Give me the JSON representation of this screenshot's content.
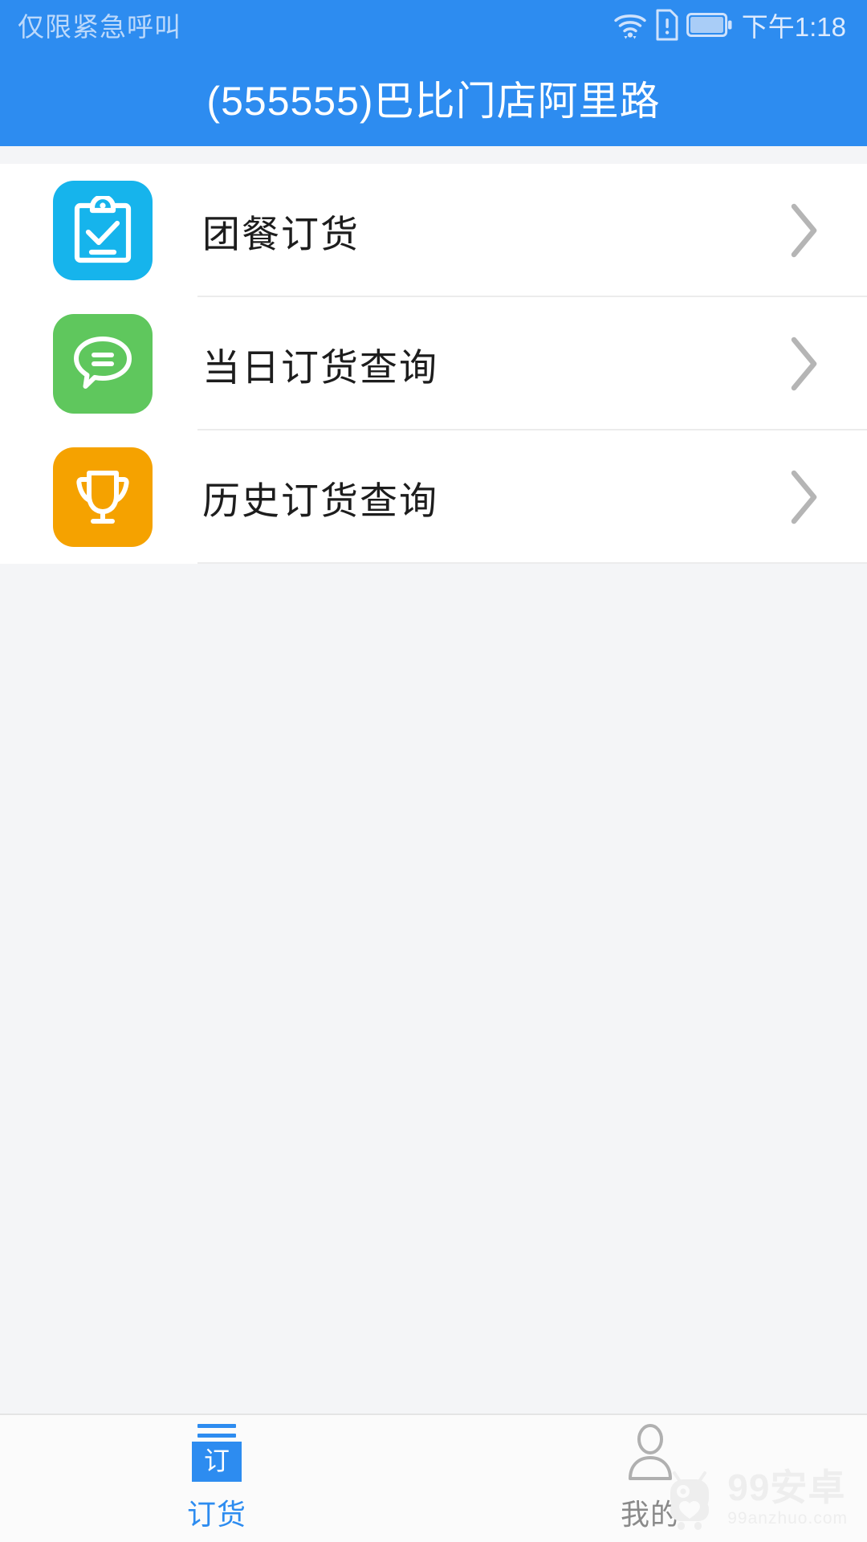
{
  "status_bar": {
    "carrier_text": "仅限紧急呼叫",
    "time": "下午1:18",
    "icons": [
      "wifi-icon",
      "sim-alert-icon",
      "battery-icon"
    ]
  },
  "header": {
    "title": "(555555)巴比门店阿里路",
    "background_color": "#2d8cf0",
    "title_color": "#ffffff"
  },
  "menu": {
    "items": [
      {
        "label": "团餐订货",
        "icon": "clipboard-check-icon",
        "tile_color": "#16b4ec",
        "chevron": "chevron-right-icon"
      },
      {
        "label": "当日订货查询",
        "icon": "chat-bubble-icon",
        "tile_color": "#5fc75d",
        "chevron": "chevron-right-icon"
      },
      {
        "label": "历史订货查询",
        "icon": "trophy-icon",
        "tile_color": "#f5a200",
        "chevron": "chevron-right-icon"
      }
    ]
  },
  "tab_bar": {
    "tabs": [
      {
        "label": "订货",
        "icon": "order-book-icon",
        "icon_glyph": "订",
        "active": true,
        "color": "#2d8cf0"
      },
      {
        "label": "我的",
        "icon": "user-person-icon",
        "active": false,
        "color": "#8a8a8a"
      }
    ]
  },
  "watermark": {
    "main": "99安卓",
    "sub": "99anzhuo.com",
    "icon": "android-robot-icon"
  }
}
